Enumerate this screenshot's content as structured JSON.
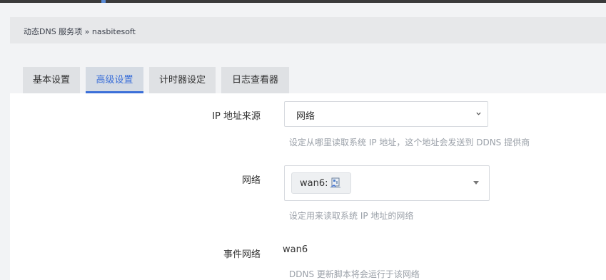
{
  "breadcrumb": {
    "text": "动态DNS 服务项 » nasbitesoft"
  },
  "tabs": [
    {
      "label": "基本设置",
      "active": false
    },
    {
      "label": "高级设置",
      "active": true
    },
    {
      "label": "计时器设定",
      "active": false
    },
    {
      "label": "日志查看器",
      "active": false
    }
  ],
  "form": {
    "ip_source": {
      "label": "IP 地址来源",
      "value": "网络",
      "hint": "设定从哪里读取系统 IP 地址，这个地址会发送到 DDNS 提供商"
    },
    "network": {
      "label": "网络",
      "chip": "wan6:",
      "chip_icon": "network-interface-icon",
      "hint": "设定用来读取系统 IP 地址的网络"
    },
    "event_network": {
      "label": "事件网络",
      "value": "wan6",
      "hint": "DDNS 更新脚本将会运行于该网络"
    }
  },
  "colors": {
    "accent": "#3b6fd8",
    "hint": "#9aa0a8",
    "background": "#f2f3f5",
    "panel": "#ffffff"
  }
}
